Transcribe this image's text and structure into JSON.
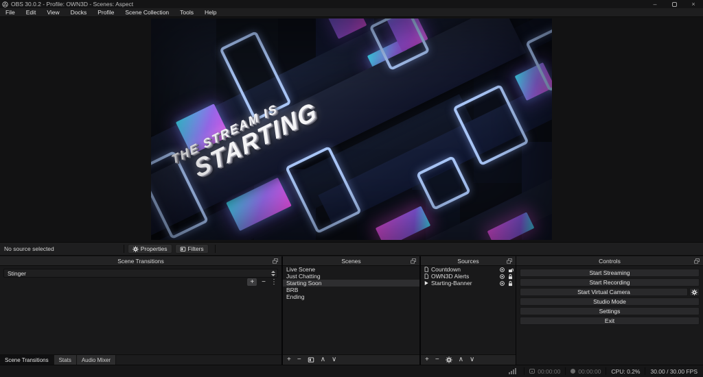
{
  "window": {
    "title": "OBS 30.0.2 - Profile: OWN3D - Scenes: Aspect",
    "controls": {
      "minimize": "–",
      "close": "×"
    }
  },
  "menu": {
    "items": [
      "File",
      "Edit",
      "View",
      "Docks",
      "Profile",
      "Scene Collection",
      "Tools",
      "Help"
    ]
  },
  "preview": {
    "artwork_line1": "THE STREAM IS",
    "artwork_line2": "STARTING"
  },
  "source_bar": {
    "status": "No source selected",
    "properties_label": "Properties",
    "filters_label": "Filters"
  },
  "transitions": {
    "header": "Scene Transitions",
    "current": "Stinger"
  },
  "scenes": {
    "header": "Scenes",
    "items": [
      "Live Scene",
      "Just Chatting",
      "Starting Soon",
      "BRB",
      "Ending"
    ],
    "selected": "Starting Soon"
  },
  "sources": {
    "header": "Sources",
    "items": [
      {
        "name": "Countdown",
        "type": "browser-source",
        "visible": true,
        "locked": false
      },
      {
        "name": "OWN3D Alerts",
        "type": "browser-source",
        "visible": true,
        "locked": true
      },
      {
        "name": "Starting-Banner",
        "type": "media-source",
        "visible": true,
        "locked": true
      }
    ]
  },
  "controls": {
    "header": "Controls",
    "buttons": [
      "Start Streaming",
      "Start Recording",
      "Start Virtual Camera",
      "Studio Mode",
      "Settings",
      "Exit"
    ]
  },
  "dock_tabs": {
    "items": [
      "Scene Transitions",
      "Stats",
      "Audio Mixer"
    ],
    "active": "Scene Transitions"
  },
  "status_bar": {
    "stream_time": "00:00:00",
    "record_time": "00:00:00",
    "cpu": "CPU: 0.2%",
    "fps": "30.00 / 30.00 FPS"
  },
  "glyphs": {
    "plus": "+",
    "minus": "−",
    "kebab": "⋮",
    "chev_up": "∧",
    "chev_down": "∨"
  },
  "colors": {
    "accent_cyan": "#3fdcf5",
    "accent_magenta": "#e64ee2",
    "wire_blue": "#a9c6f7"
  }
}
